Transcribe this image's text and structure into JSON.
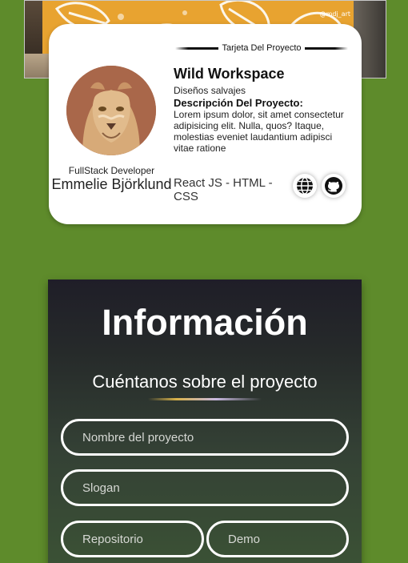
{
  "banner": {
    "handle": "@mdj_art"
  },
  "card": {
    "kicker": "Tarjeta Del Proyecto",
    "project_title": "Wild Workspace",
    "slogan": "Diseños salvajes",
    "description_label": "Descripción Del Proyecto:",
    "description": "Lorem ipsum dolor, sit amet consectetur adipisicing elit. Nulla, quos? Itaque, molestias eveniet laudantium adipisci vitae ratione",
    "tech": "React JS - HTML - CSS",
    "role": "FullStack Developer",
    "person_name": "Emmelie Björklund",
    "icons": [
      "globe-icon",
      "github-icon"
    ]
  },
  "form": {
    "title": "Información",
    "subtitle": "Cuéntanos sobre el proyecto",
    "fields": {
      "name_placeholder": "Nombre del proyecto",
      "slogan_placeholder": "Slogan",
      "repo_placeholder": "Repositorio",
      "demo_placeholder": "Demo"
    }
  },
  "colors": {
    "background": "#5e8b2b",
    "card": "#ffffff",
    "panel_top": "#1f1e28",
    "panel_bottom": "#3b5235",
    "accent_gold": "#d8b24a"
  }
}
